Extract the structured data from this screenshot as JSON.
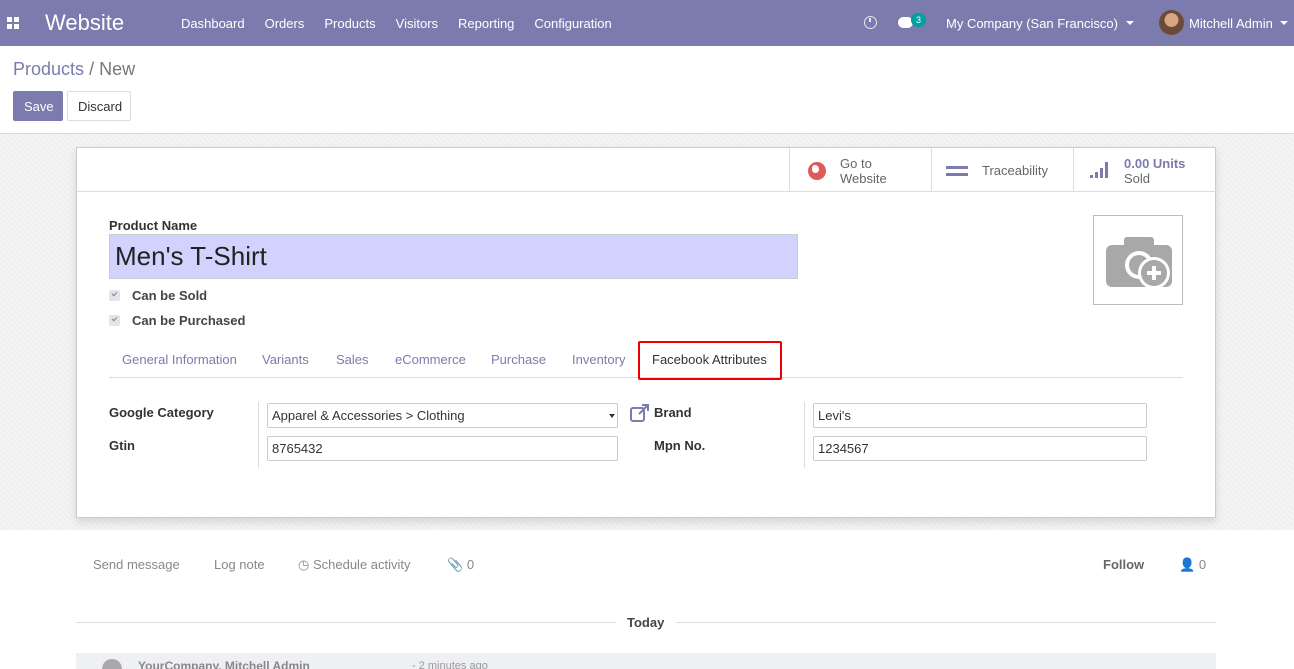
{
  "navbar": {
    "brand": "Website",
    "menu": [
      "Dashboard",
      "Orders",
      "Products",
      "Visitors",
      "Reporting",
      "Configuration"
    ],
    "chat_count": "3",
    "company": "My Company (San Francisco)",
    "user": "Mitchell Admin"
  },
  "breadcrumb": {
    "parent": "Products",
    "separator": "/",
    "current": "New"
  },
  "actions": {
    "save": "Save",
    "discard": "Discard"
  },
  "button_box": {
    "website": [
      "Go to",
      "Website"
    ],
    "traceability": "Traceability",
    "sold": [
      "0.00 Units",
      "Sold"
    ]
  },
  "form": {
    "product_name_label": "Product Name",
    "product_name_value": "Men's T-Shirt",
    "can_be_sold": "Can be Sold",
    "can_be_purchased": "Can be Purchased"
  },
  "tabs": [
    "General Information",
    "Variants",
    "Sales",
    "eCommerce",
    "Purchase",
    "Inventory",
    "Facebook Attributes"
  ],
  "active_tab": "Facebook Attributes",
  "facebook": {
    "google_category_label": "Google Category",
    "google_category_value": "Apparel & Accessories > Clothing",
    "gtin_label": "Gtin",
    "gtin_value": "8765432",
    "brand_label": "Brand",
    "brand_value": "Levi's",
    "mpn_label": "Mpn No.",
    "mpn_value": "1234567"
  },
  "chatter": {
    "send_message": "Send message",
    "log_note": "Log note",
    "schedule_activity": "Schedule activity",
    "attachments": "0",
    "follow": "Follow",
    "followers": "0",
    "today": "Today",
    "msg_author": "YourCompany, Mitchell Admin",
    "msg_time": "- 2 minutes ago"
  },
  "colors": {
    "brand": "#7c7bad",
    "highlight": "#e00000",
    "name_bg": "#d2d2ff"
  }
}
